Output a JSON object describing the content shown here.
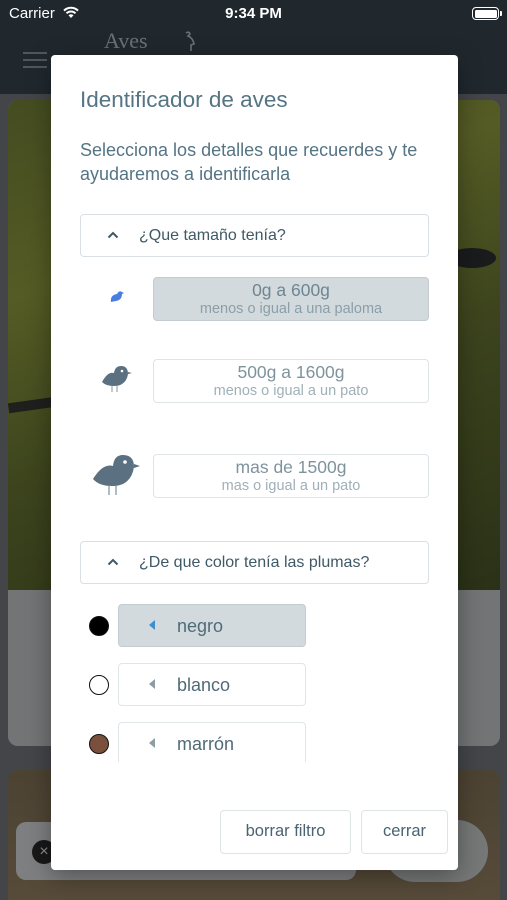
{
  "status_bar": {
    "carrier": "Carrier",
    "time": "9:34 PM"
  },
  "app": {
    "logo_text": "Aves"
  },
  "modal": {
    "title": "Identificador de aves",
    "subtitle": "Selecciona los detalles que recuerdes y te ayudaremos a identificarla",
    "size_section": {
      "header": "¿Que tamaño tenía?",
      "options": [
        {
          "main": "0g a 600g",
          "sub": "menos o igual a una paloma",
          "selected": true,
          "icon": "small-bird-icon"
        },
        {
          "main": "500g a 1600g",
          "sub": "menos o igual a un pato",
          "selected": false,
          "icon": "medium-bird-icon"
        },
        {
          "main": "mas de 1500g",
          "sub": "mas o igual a un pato",
          "selected": false,
          "icon": "large-bird-icon"
        }
      ]
    },
    "color_section": {
      "header": "¿De que color tenía las plumas?",
      "options": [
        {
          "label": "negro",
          "swatch": "#000000",
          "selected": true
        },
        {
          "label": "blanco",
          "swatch": "#ffffff",
          "selected": false
        },
        {
          "label": "marrón",
          "swatch": "#7a4f3c",
          "selected": false
        }
      ]
    },
    "buttons": {
      "clear": "borrar filtro",
      "close": "cerrar"
    }
  },
  "colors": {
    "accent": "#3b8fd4",
    "title": "#557484",
    "selected_bg": "#d2dade",
    "header_bg": "#3b4a55"
  }
}
